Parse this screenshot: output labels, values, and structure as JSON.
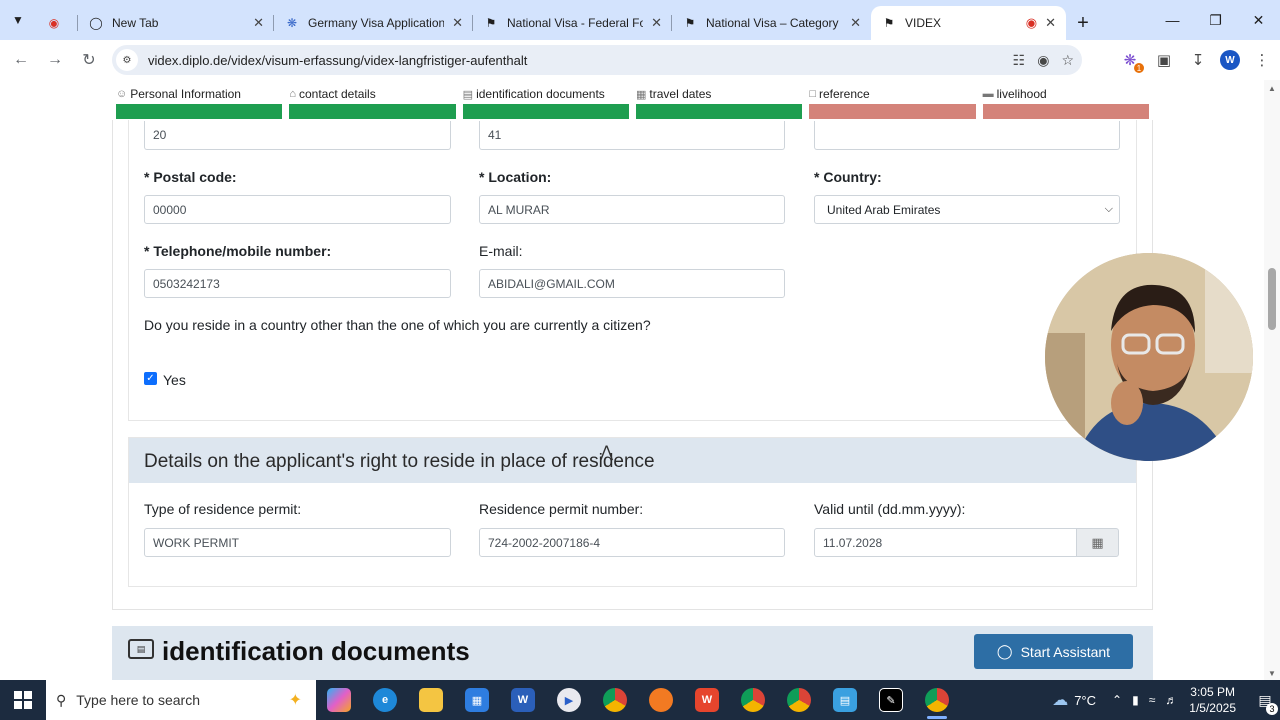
{
  "browser": {
    "tabs": [
      {
        "title": "",
        "favicon": "record-dot-icon",
        "closable": false
      },
      {
        "title": "New Tab",
        "favicon": "chrome-icon"
      },
      {
        "title": "Germany Visa Application",
        "favicon": "gear-flower-icon"
      },
      {
        "title": "National Visa - Federal For",
        "favicon": "german-flag-icon"
      },
      {
        "title": "National Visa – Category D",
        "favicon": "german-flag-icon"
      },
      {
        "title": "VIDEX",
        "favicon": "german-flag-icon",
        "active": true,
        "recording": true
      }
    ],
    "url": "videx.diplo.de/videx/visum-erfassung/videx-langfristiger-aufenthalt"
  },
  "progress": {
    "steps": [
      {
        "label": "Personal Information",
        "icon": "person-icon",
        "status": "done"
      },
      {
        "label": "contact details",
        "icon": "home-icon",
        "status": "done"
      },
      {
        "label": "identification documents",
        "icon": "id-card-icon",
        "status": "done"
      },
      {
        "label": "travel dates",
        "icon": "map-icon",
        "status": "done"
      },
      {
        "label": "reference",
        "icon": "document-icon",
        "status": "pending"
      },
      {
        "label": "livelihood",
        "icon": "money-icon",
        "status": "pending"
      }
    ],
    "colors": {
      "done": "#1e9e50",
      "pending": "#d4837a"
    }
  },
  "contact": {
    "row0": {
      "field1_value": "20",
      "field2_value": "41",
      "field3_value": ""
    },
    "postal_code": {
      "label": "* Postal code:",
      "value": "00000"
    },
    "location": {
      "label": "* Location:",
      "value": "AL MURAR"
    },
    "country": {
      "label": "* Country:",
      "value": "United Arab Emirates"
    },
    "phone": {
      "label": "* Telephone/mobile number:",
      "value": "0503242173"
    },
    "email": {
      "label": "E-mail:",
      "value": "ABIDALI@GMAIL.COM"
    },
    "reside_question": "Do you reside in a country other than the one of which you are currently a citizen?",
    "reside_answer": {
      "label": "Yes",
      "checked": true
    }
  },
  "residence": {
    "title": "Details on the applicant's right to reside in place of residence",
    "permit_type": {
      "label": "Type of residence permit:",
      "value": "WORK PERMIT"
    },
    "permit_number": {
      "label": "Residence permit number:",
      "value": "724-2002-2007186-4"
    },
    "valid_until": {
      "label": "Valid until (dd.mm.yyyy):",
      "value": "11.07.2028"
    }
  },
  "id_section": {
    "title": "identification documents",
    "assistant_button": "Start Assistant"
  },
  "taskbar": {
    "search_placeholder": "Type here to search",
    "apps": [
      "copilot",
      "edge",
      "file-explorer",
      "store",
      "word",
      "media-player",
      "chrome",
      "firefox",
      "wps",
      "chrome-profile-1",
      "chrome-profile-2",
      "notepad",
      "capcut",
      "chrome-active"
    ],
    "weather": "7°C",
    "time": "3:05 PM",
    "date": "1/5/2025",
    "notifications": "3"
  }
}
